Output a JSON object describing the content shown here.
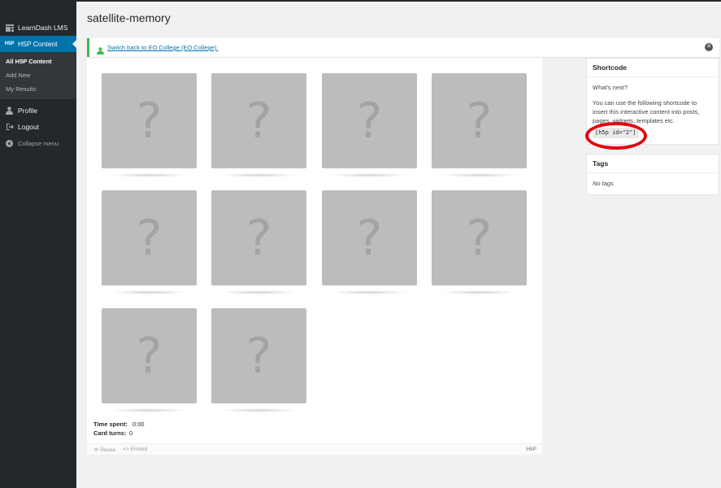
{
  "sidebar": {
    "items": [
      {
        "label": "LearnDash LMS",
        "icon": "learndash-icon"
      },
      {
        "label": "H5P Content",
        "icon": "h5p-icon",
        "icon_text": "H5P"
      },
      {
        "label": "Profile",
        "icon": "user-icon"
      },
      {
        "label": "Logout",
        "icon": "logout-icon"
      },
      {
        "label": "Collapse menu",
        "icon": "collapse-icon"
      }
    ],
    "submenu": [
      {
        "label": "All H5P Content",
        "current": true
      },
      {
        "label": "Add New"
      },
      {
        "label": "My Results"
      }
    ]
  },
  "page": {
    "title": "satellite-memory"
  },
  "notice": {
    "link_text": "Switch back to EO College (EO College).",
    "close": "✕"
  },
  "game": {
    "card_symbol": "?",
    "card_count": 10,
    "time_label": "Time spent:",
    "time_value": "0:00",
    "turns_label": "Card turns:",
    "turns_value": "0"
  },
  "footer": {
    "reuse": "Reuse",
    "embed": "Embed",
    "logo": "H5P"
  },
  "shortcode_box": {
    "title": "Shortcode",
    "question": "What's next?",
    "text": "You can use the following shortcode to insert this interactive content into posts, pages, widgets, templates etc.",
    "code": "[h5p id=\"2\"]"
  },
  "tags_box": {
    "title": "Tags",
    "empty": "No tags"
  },
  "colors": {
    "sidebar_bg": "#23282d",
    "accent": "#0073aa",
    "notice_border": "#46b450",
    "highlight": "#e3000f",
    "card": "#bcbcbc"
  }
}
